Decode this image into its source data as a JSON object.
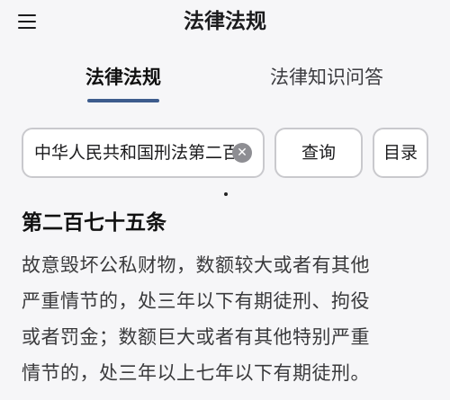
{
  "header": {
    "title": "法律法规",
    "menu_icon": "hamburger-menu-icon"
  },
  "tabs": [
    {
      "label": "法律法规",
      "active": true
    },
    {
      "label": "法律知识问答",
      "active": false
    }
  ],
  "search": {
    "value": "中华人民共和国刑法第二百",
    "clear_icon": "clear-circle-icon",
    "search_button_label": "查询",
    "catalog_button_label": "目录"
  },
  "article": {
    "title": "第二百七十五条",
    "lines": [
      "故意毁坏公私财物，数额较大或者有其他",
      "严重情节的，处三年以下有期徒刑、拘役",
      "或者罚金；数额巨大或者有其他特别严重",
      "情节的，处三年以上七年以下有期徒刑。"
    ]
  },
  "colors": {
    "accent": "#3d5c8d",
    "background": "#f6f6f8"
  }
}
